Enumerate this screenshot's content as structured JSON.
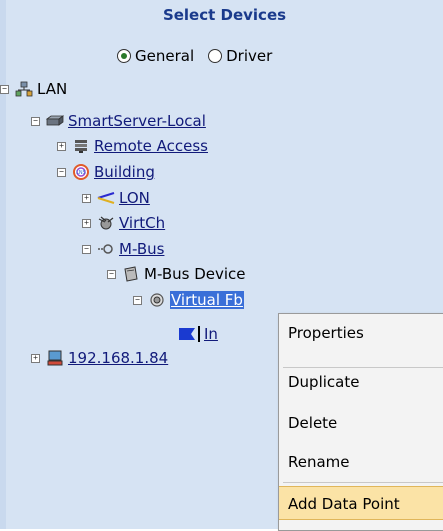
{
  "header": {
    "title": "Select Devices"
  },
  "mode": {
    "general": "General",
    "driver": "Driver",
    "selected": "general"
  },
  "tree": {
    "lan": "LAN",
    "smartserver": "SmartServer-Local",
    "remote_access": "Remote Access",
    "building": "Building",
    "lon": "LON",
    "virtch": "VirtCh",
    "mbus": "M-Bus",
    "mbus_device": "M-Bus Device",
    "virtual_fb": "Virtual Fb",
    "in": "In",
    "ip": "192.168.1.84"
  },
  "context_menu": {
    "items": [
      "Properties",
      "Duplicate",
      "Delete",
      "Rename",
      "Add Data Point"
    ],
    "highlighted": "Add Data Point"
  },
  "colors": {
    "panel": "#d6e3f3",
    "header_text": "#1a3a8c",
    "link": "#111a7a",
    "menu_highlight": "#fbe3a6"
  }
}
